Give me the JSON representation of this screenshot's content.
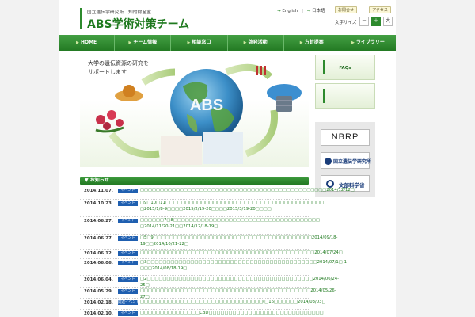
{
  "header": {
    "logo_sub": "国立遺伝学研究所　知的財産室",
    "logo_main": "ABS学術対策チーム",
    "lang_en": "English",
    "lang_ja": "日本語",
    "btn_contact": "お問合せ",
    "btn_access": "アクセス",
    "fontsize_label": "文字サイズ",
    "fontsize_small": "－",
    "fontsize_mid": "＋",
    "fontsize_large": "大"
  },
  "nav": {
    "items": [
      "HOME",
      "チーム情報",
      "相談窓口",
      "啓発活動",
      "方針提案",
      "ライブラリー"
    ]
  },
  "hero": {
    "line1": "大学の遺伝資源の研究を",
    "line2": "サポートします",
    "globe_text": "ABS"
  },
  "sidebar": {
    "faq_label": "FAQs",
    "box2_label": "",
    "banner_nbrp": "NBRP",
    "banner_nig": "国立遺伝学研究所",
    "banner_mext": "文部科学省"
  },
  "news": {
    "heading": "お知らせ",
    "items": [
      {
        "date": "2014.11.07.",
        "badge": "イベント",
        "text": "□□□□□□□□□□□□□□□□□□□□□□□□□□□□□□□□□□□□□□□□□□□□□□□2014/12/12□"
      },
      {
        "date": "2014.10.23.",
        "badge": "イベント",
        "text": "□9□10□11□□□□□□□□□□□□□□□□□□□□□□□□□□□□□□□□□□□□□□□□\n□2015/1/8-9□□□□2015/2/19-20□□□□2015/3/19-20□□□□"
      },
      {
        "date": "2014.06.27.",
        "badge": "イベント",
        "text": "□□□□□□7□8□□□□□□□□□□□□□□□□□□□□□□□□□□□□□□□□□□□□□\n□2014/11/20-21□□2014/12/18-19□"
      },
      {
        "date": "2014.06.27.",
        "badge": "イベント",
        "text": "□5□9□□□□□□□□□□□□□□□□□□□□□□□□□□□□□□□□□□□□□□□□2014/09/18-\n19□□2014/10/21-22□"
      },
      {
        "date": "2014.06.12.",
        "badge": "イベント",
        "text": "□□□□□□□□□□□□□□□□□□□□□□□□□□□□□□□□□□□□□□□□□□□□2014/07/24□"
      },
      {
        "date": "2014.06.06.",
        "badge": "イベント",
        "text": "□3□□□□□□□□□□□□□□□□□□□□□□□□□□□□□□□□□□□□□□□□□□□2014/07/1□-1\n□□□2014/08/18-19□"
      },
      {
        "date": "2014.06.04.",
        "badge": "イベント",
        "text": "□2□□□□□□□□□□□□□□□□□□□□□□□□□□□□□□□□□□□□□□□□□□2014/06/24-25□"
      },
      {
        "date": "2014.05.29.",
        "badge": "イベント",
        "text": "□□□□□□□□□□□□□□□□□□□□□□□□□□□□□□□□□□□□□□□□□□□2014/05/26-27□"
      },
      {
        "date": "2014.02.18.",
        "badge": "関連イベント",
        "text": "□□□□□□□□□□□□□□□□□□□□□□□□□□□□□□□(□16□□□□□□2014/03/03□"
      },
      {
        "date": "2014.02.10.",
        "badge": "イベント",
        "text": "□□□□□□□□□□□□□□□CBD□□□□□□□□□□□□□□□□□□□□□□□□□□□□□"
      }
    ]
  },
  "colors": {
    "brand_green": "#2d8a2d",
    "badge_blue": "#1f5fb0"
  }
}
